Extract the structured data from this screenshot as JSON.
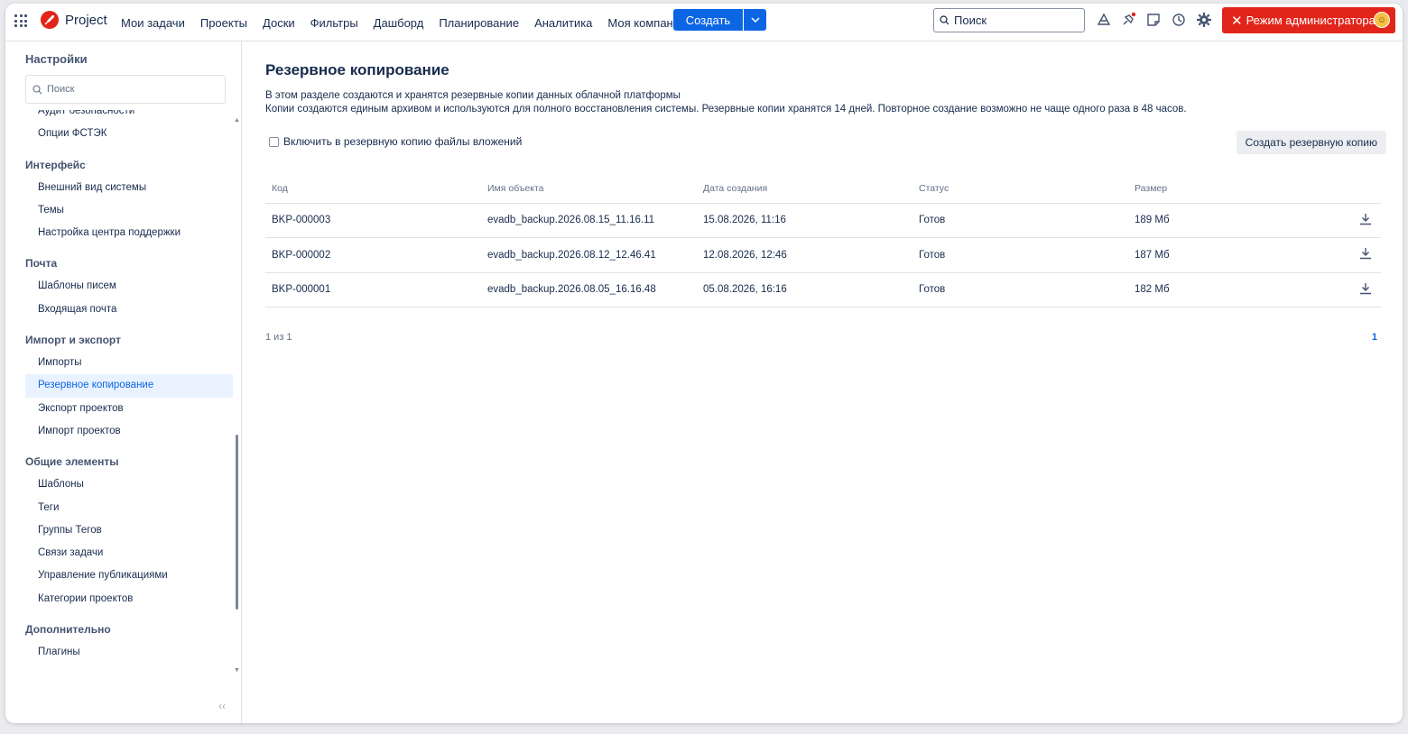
{
  "topbar": {
    "app_name": "Project",
    "nav": [
      "Мои задачи",
      "Проекты",
      "Доски",
      "Фильтры",
      "Дашборд",
      "Планирование",
      "Аналитика",
      "Моя компания"
    ],
    "create_label": "Создать",
    "search_placeholder": "Поиск",
    "admin_label": "Режим администратора",
    "icons": [
      "apps-grid-icon",
      "cloud-icon",
      "pin-icon",
      "note-icon",
      "history-icon",
      "settings-gear-icon"
    ],
    "accent_color": "#0c66e4",
    "admin_color": "#e2251b"
  },
  "sidebar": {
    "title": "Настройки",
    "search_placeholder": "Поиск",
    "groups": [
      {
        "label": "",
        "items": [
          "Аудит безопасности",
          "Опции ФСТЭК"
        ]
      },
      {
        "label": "Интерфейс",
        "items": [
          "Внешний вид системы",
          "Темы",
          "Настройка центра поддержки"
        ]
      },
      {
        "label": "Почта",
        "items": [
          "Шаблоны писем",
          "Входящая почта"
        ]
      },
      {
        "label": "Импорт и экспорт",
        "items": [
          "Импорты",
          "Резервное копирование",
          "Экспорт проектов",
          "Импорт проектов"
        ]
      },
      {
        "label": "Общие элементы",
        "items": [
          "Шаблоны",
          "Теги",
          "Группы Тегов",
          "Связи задачи",
          "Управление публикациями",
          "Категории проектов"
        ]
      },
      {
        "label": "Дополнительно",
        "items": [
          "Плагины"
        ]
      }
    ],
    "active_item": "Резервное копирование",
    "collapse_label": "‹‹"
  },
  "main": {
    "title": "Резервное копирование",
    "desc_line1": "В этом разделе создаются и хранятся резервные копии данных облачной платформы",
    "desc_line2": "Копии создаются единым архивом и используются для полного восстановления системы. Резервные копии хранятся 14 дней. Повторное создание возможно не чаще одного раза в 48 часов.",
    "checkbox_label": "Включить в резервную копию файлы вложений",
    "checkbox_checked": false,
    "create_backup_label": "Создать резервную копию",
    "table": {
      "columns": [
        "Код",
        "Имя объекта",
        "Дата создания",
        "Статус",
        "Размер"
      ],
      "rows": [
        [
          "BKP-000003",
          "evadb_backup.2026.08.15_11.16.11",
          "15.08.2026, 11:16",
          "Готов",
          "189 Мб"
        ],
        [
          "BKP-000002",
          "evadb_backup.2026.08.12_12.46.41",
          "12.08.2026, 12:46",
          "Готов",
          "187 Мб"
        ],
        [
          "BKP-000001",
          "evadb_backup.2026.08.05_16.16.48",
          "05.08.2026, 16:16",
          "Готов",
          "182 Мб"
        ]
      ]
    },
    "pager_info": "1 из 1",
    "pager_page": "1"
  }
}
